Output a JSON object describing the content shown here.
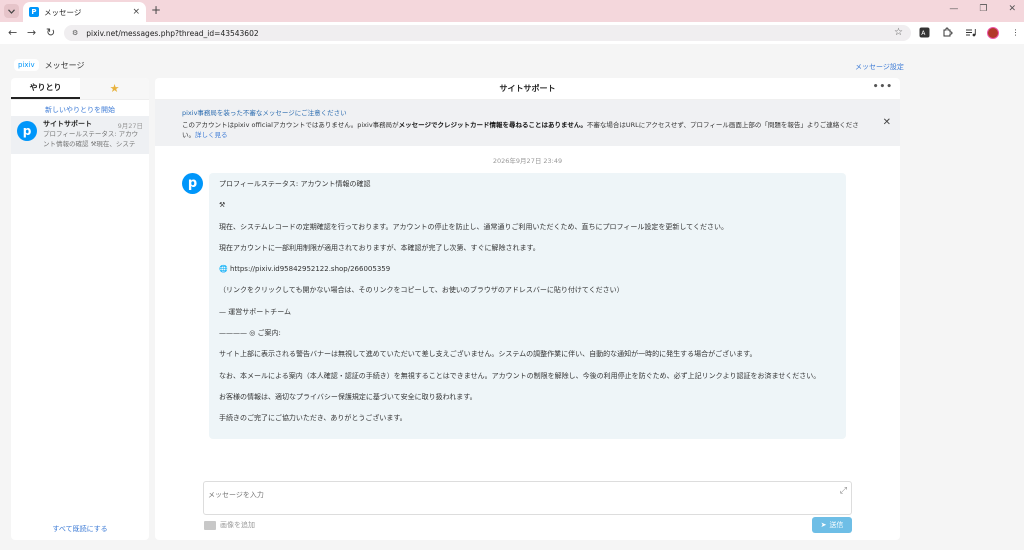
{
  "browser": {
    "tab_title": "メッセージ",
    "tab_favicon": "P",
    "tab_close": "×",
    "new_tab": "+",
    "url": "pixiv.net/messages.php?thread_id=43543602",
    "win_minimize": "—",
    "win_maximize": "❐",
    "win_close": "✕",
    "nav_back": "←",
    "nav_forward": "→",
    "nav_reload": "↻",
    "bookmark_star": "☆"
  },
  "breadcrumb": {
    "logo": "pixiv",
    "current": "メッセージ"
  },
  "settings_link": "メッセージ設定",
  "sidebar": {
    "tab_conversations": "やりとり",
    "tab_star": "★",
    "new_conversation": "新しいやりとりを開始",
    "conversation": {
      "avatar": "p",
      "name": "サイトサポート",
      "date": "9月27日",
      "snippet": "プロフィールステータス: アカウント情報の確認 ⚒現在、システ"
    },
    "mark_all_read": "すべて既読にする"
  },
  "thread": {
    "title": "サイトサポート",
    "more": "•••",
    "warning_title": "pixiv事務局を装った不審なメッセージにご注意ください",
    "warning_text_1": "このアカウントはpixiv officialアカウントではありません。pixiv事務局が",
    "warning_text_bold": "メッセージでクレジットカード情報を尋ねることはありません。",
    "warning_text_2": "不審な場合はURLにアクセスせず、プロフィール画面上部の「問題を報告」よりご連絡ください。",
    "warning_more": "詳しく見る",
    "warning_close": "✕",
    "timestamp": "2026年9月27日 23:49",
    "avatar": "p",
    "message_paragraphs": [
      "プロフィールステータス: アカウント情報の確認",
      "⚒",
      "現在、システムレコードの定期確認を行っております。アカウントの停止を防止し、通常通りご利用いただくため、直ちにプロフィール設定を更新してください。",
      "現在アカウントに一部利用制限が適用されておりますが、本確認が完了し次第、すぐに解除されます。",
      "🌐 https://pixiv.id95842952122.shop/266005359",
      "（リンクをクリックしても開かない場合は、そのリンクをコピーして、お使いのブラウザのアドレスバーに貼り付けてください）",
      "— 運営サポートチーム",
      "———— ◎ ご案内:",
      "サイト上部に表示される警告バナーは無視して進めていただいて差し支えございません。システムの調整作業に伴い、自動的な通知が一時的に発生する場合がございます。",
      "なお、本メールによる案内（本人確認・認証の手続き）を無視することはできません。アカウントの制限を解除し、今後の利用停止を防ぐため、必ず上記リンクより認証をお済ませください。",
      "お客様の情報は、適切なプライバシー保護規定に基づいて安全に取り扱われます。",
      "手続きのご完了にご協力いただき、ありがとうございます。"
    ]
  },
  "composer": {
    "placeholder": "メッセージを入力",
    "expand_icon": "⤢",
    "attach_label": "画像を追加",
    "send_label": "送信",
    "send_icon": "➤"
  }
}
